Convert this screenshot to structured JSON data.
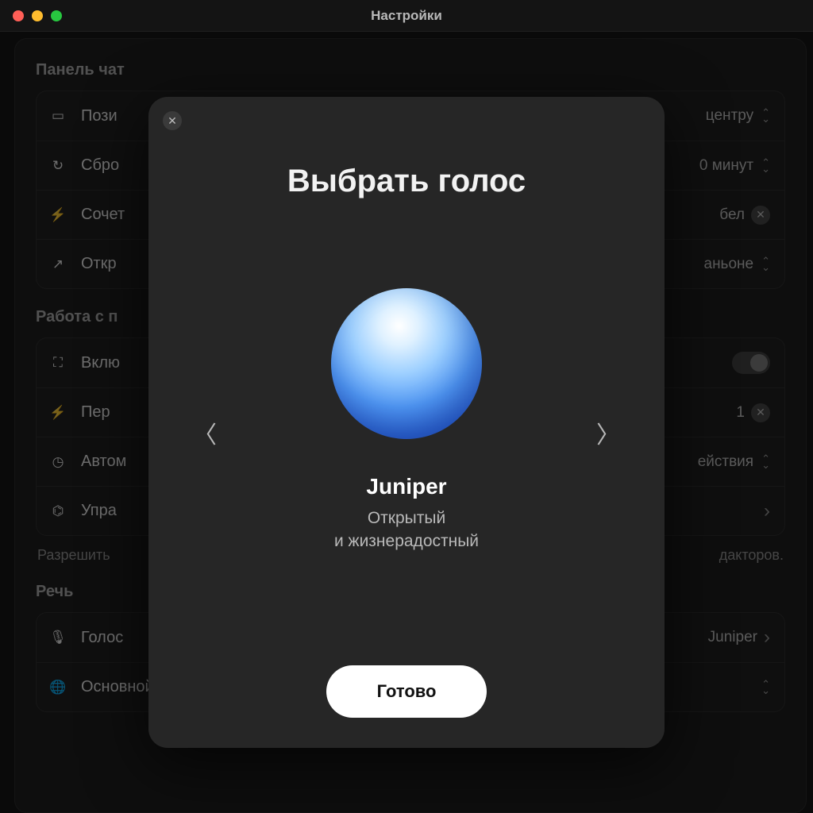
{
  "window": {
    "title": "Настройки"
  },
  "sections": {
    "chatPanel": {
      "title": "Панель чат",
      "rows": {
        "position": {
          "label": "Пози",
          "value": "центру"
        },
        "reset": {
          "label": "Сбро",
          "value": "0 минут"
        },
        "shortcut": {
          "label": "Сочет",
          "value": "бел"
        },
        "open": {
          "label": "Откр",
          "value": "аньоне"
        }
      }
    },
    "workWith": {
      "title": "Работа с п",
      "rows": {
        "enable": {
          "label": "Вклю"
        },
        "per": {
          "label": "Пер",
          "value": "1"
        },
        "auto": {
          "label": "Автом",
          "value": "ействия"
        },
        "manage": {
          "label": "Упра"
        }
      },
      "help": "Разрешить                                                                                                                              дакторов."
    },
    "speech": {
      "title": "Речь",
      "rows": {
        "voice": {
          "label": "Голос",
          "value": "Juniper"
        },
        "language": {
          "label": "Основной язык"
        }
      }
    }
  },
  "modal": {
    "title": "Выбрать голос",
    "voice": {
      "name": "Juniper",
      "desc_line1": "Открытый",
      "desc_line2": "и жизнерадостный"
    },
    "done": "Готово"
  }
}
